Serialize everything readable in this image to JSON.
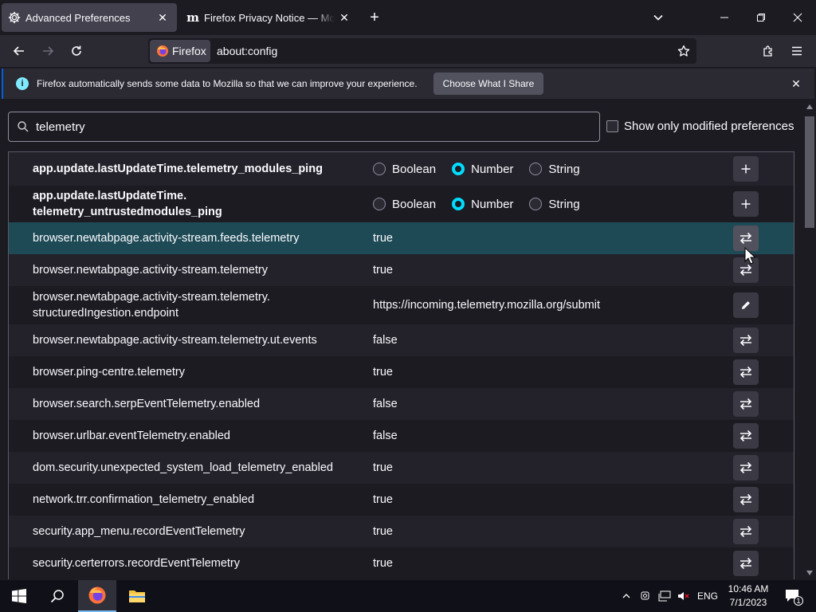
{
  "tabs": [
    {
      "title": "Advanced Preferences",
      "icon": "gear-icon",
      "active": true
    },
    {
      "title": "Firefox Privacy Notice — Mozilla",
      "icon": "mozilla-m-icon",
      "icon_text": "m",
      "active": false
    }
  ],
  "navbar": {
    "identity_label": "Firefox",
    "url": "about:config"
  },
  "notification": {
    "text": "Firefox automatically sends some data to Mozilla so that we can improve your experience.",
    "button_label": "Choose What I Share",
    "info_glyph": "i"
  },
  "search": {
    "value": "telemetry"
  },
  "modified_only_label": "Show only modified preferences",
  "type_labels": {
    "boolean": "Boolean",
    "number": "Number",
    "string": "String"
  },
  "prefs": [
    {
      "name": "app.update.lastUpdateTime.telemetry_modules_ping",
      "new": true,
      "selected_type": "number",
      "action": "add"
    },
    {
      "name_line1": "app.update.lastUpdateTime.",
      "name_line2": "telemetry_untrustedmodules_ping",
      "new": true,
      "selected_type": "number",
      "action": "add"
    },
    {
      "name": "browser.newtabpage.activity-stream.feeds.telemetry",
      "value": "true",
      "action": "toggle",
      "selected": true
    },
    {
      "name": "browser.newtabpage.activity-stream.telemetry",
      "value": "true",
      "action": "toggle"
    },
    {
      "name_line1": "browser.newtabpage.activity-stream.telemetry.",
      "name_line2": "structuredIngestion.endpoint",
      "value": "https://incoming.telemetry.mozilla.org/submit",
      "action": "edit"
    },
    {
      "name": "browser.newtabpage.activity-stream.telemetry.ut.events",
      "value": "false",
      "action": "toggle"
    },
    {
      "name": "browser.ping-centre.telemetry",
      "value": "true",
      "action": "toggle"
    },
    {
      "name": "browser.search.serpEventTelemetry.enabled",
      "value": "false",
      "action": "toggle"
    },
    {
      "name": "browser.urlbar.eventTelemetry.enabled",
      "value": "false",
      "action": "toggle"
    },
    {
      "name": "dom.security.unexpected_system_load_telemetry_enabled",
      "value": "true",
      "action": "toggle"
    },
    {
      "name": "network.trr.confirmation_telemetry_enabled",
      "value": "true",
      "action": "toggle"
    },
    {
      "name": "security.app_menu.recordEventTelemetry",
      "value": "true",
      "action": "toggle"
    },
    {
      "name": "security.certerrors.recordEventTelemetry",
      "value": "true",
      "action": "toggle"
    }
  ],
  "taskbar": {
    "tray_lang": "ENG",
    "time": "10:46 AM",
    "date": "7/1/2023",
    "notification_count": "1"
  },
  "colors": {
    "accent": "#00ddff",
    "selected_row": "#1e4a56",
    "info_blue": "#80ebff"
  }
}
